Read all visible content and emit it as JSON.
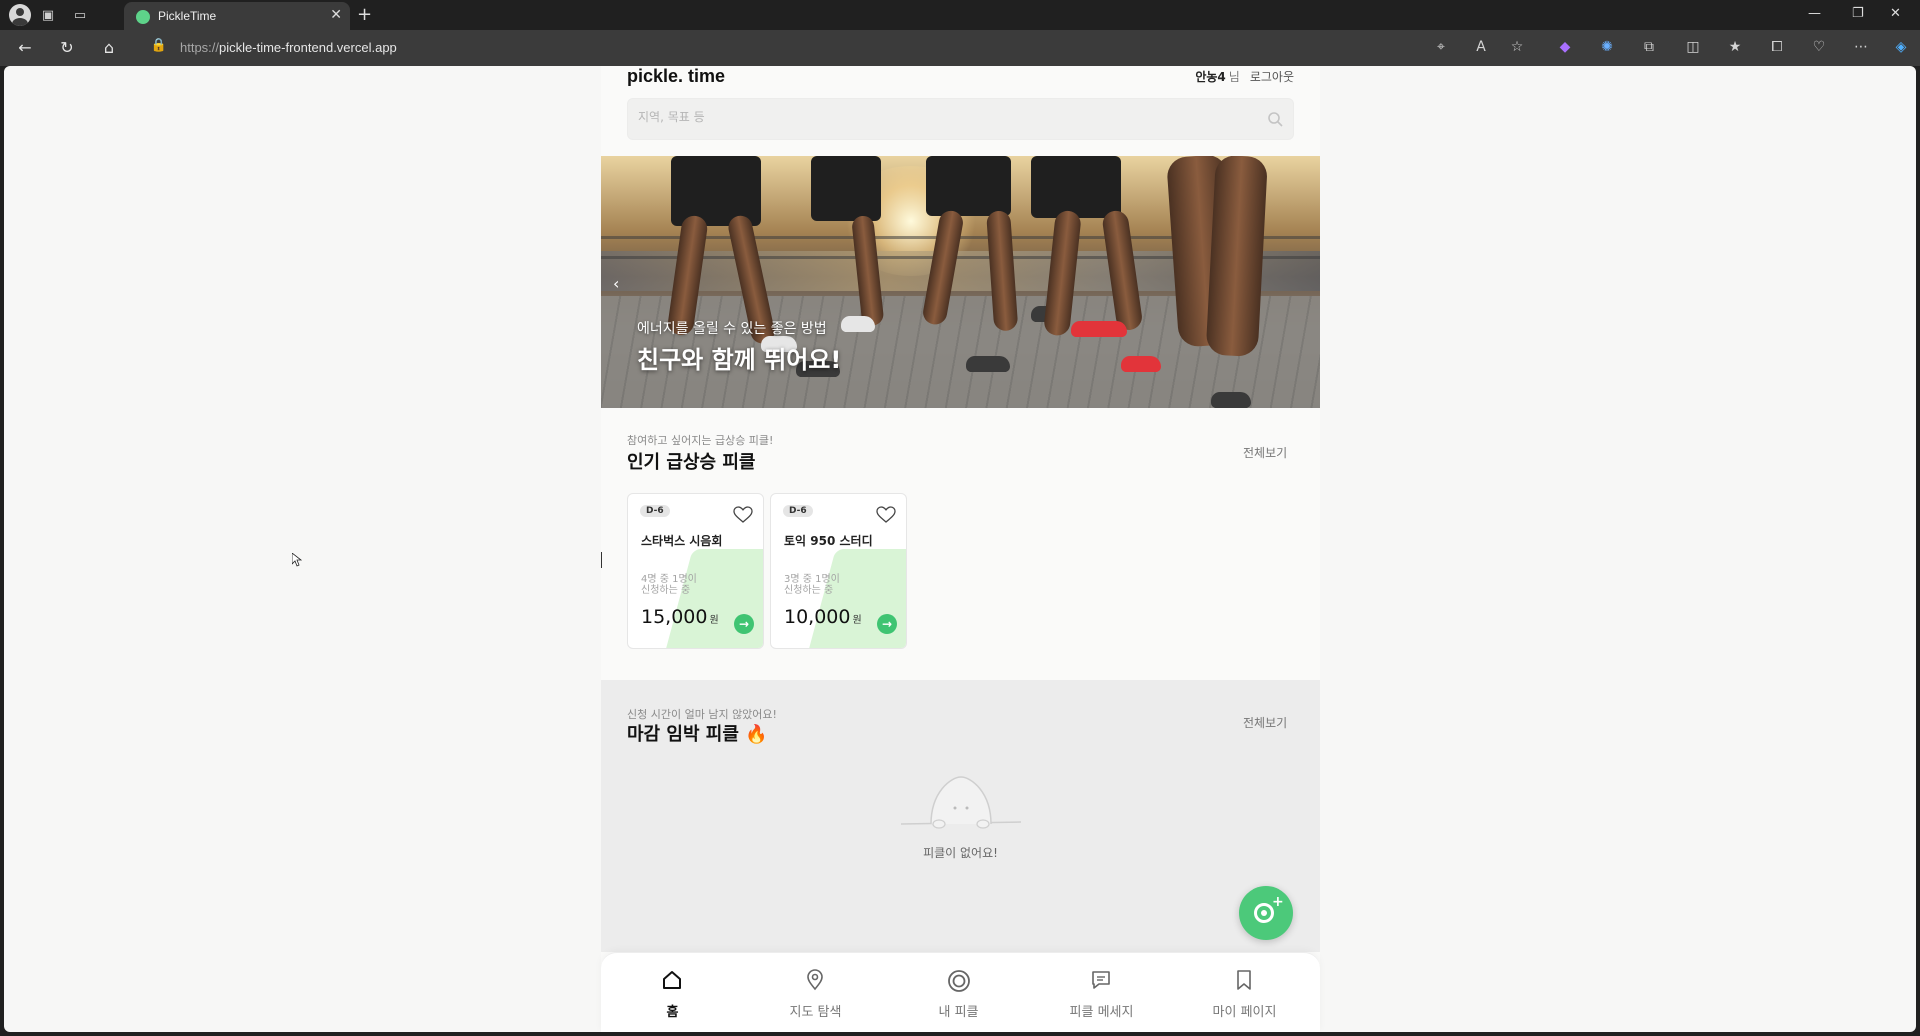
{
  "browser": {
    "tab_title": "PickleTime",
    "url_proto": "https://",
    "url_host": "pickle-time-frontend.vercel.app"
  },
  "header": {
    "logo": "pickle. time",
    "username": "안농4",
    "honorific": "님",
    "logout": "로그아웃"
  },
  "search": {
    "placeholder": "지역, 목표 등"
  },
  "banner": {
    "subtitle": "에너지를 올릴 수 있는 좋은 방법",
    "title": "친구와 함께 뛰어요!"
  },
  "popular": {
    "subtitle": "참여하고 싶어지는 급상승 피클!",
    "title": "인기 급상승 피클",
    "see_all": "전체보기",
    "cards": [
      {
        "dday": "D-6",
        "name": "스타벅스 시음회",
        "count_line1": "4명 중 1명이",
        "count_line2": "신청하는 중",
        "price": "15,000",
        "unit": "원"
      },
      {
        "dday": "D-6",
        "name": "토익 950 스터디",
        "count_line1": "3명 중 1명이",
        "count_line2": "신청하는 중",
        "price": "10,000",
        "unit": "원"
      }
    ]
  },
  "deadline": {
    "subtitle": "신청 시간이 얼마 남지 않았어요!",
    "title": "마감 임박 피클",
    "title_icon": "🔥",
    "see_all": "전체보기",
    "empty": "피클이 없어요!"
  },
  "bottom_nav": [
    {
      "label": "홈",
      "icon": "home-icon",
      "active": true
    },
    {
      "label": "지도 탐색",
      "icon": "map-pin-icon",
      "active": false
    },
    {
      "label": "내 피클",
      "icon": "pickle-ring-icon",
      "active": false
    },
    {
      "label": "피클 메세지",
      "icon": "message-icon",
      "active": false
    },
    {
      "label": "마이 페이지",
      "icon": "bookmark-icon",
      "active": false
    }
  ],
  "colors": {
    "accent": "#3fc472",
    "card_deco": "#d9f4d6",
    "page_bg": "#fafaf9"
  }
}
